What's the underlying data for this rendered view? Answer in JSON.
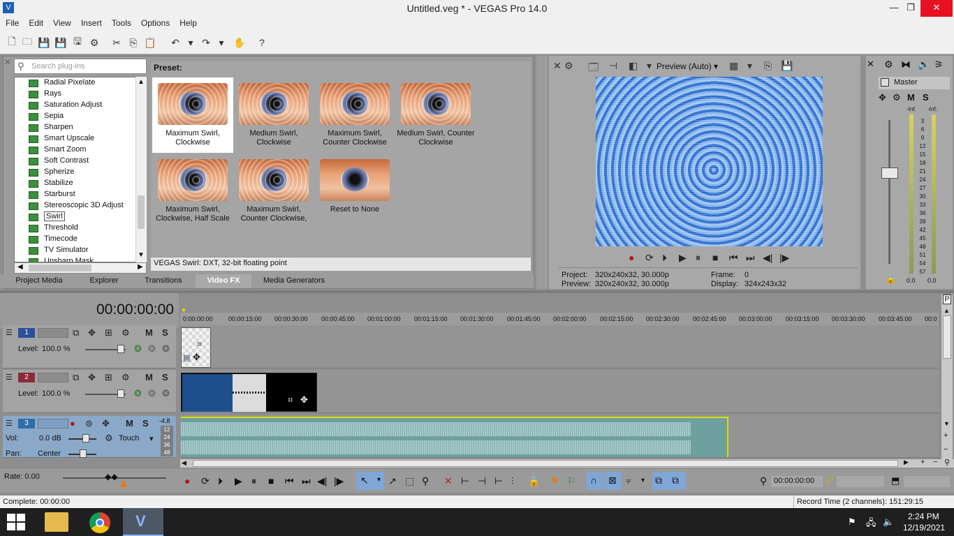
{
  "window": {
    "title": "Untitled.veg * - VEGAS Pro 14.0",
    "min": "—",
    "max": "❐",
    "close": "✕"
  },
  "menu": [
    "File",
    "Edit",
    "View",
    "Insert",
    "Tools",
    "Options",
    "Help"
  ],
  "plugins": {
    "search_placeholder": "Search plug-ins",
    "items": [
      "Radial Pixelate",
      "Rays",
      "Saturation Adjust",
      "Sepia",
      "Sharpen",
      "Smart Upscale",
      "Smart Zoom",
      "Soft Contrast",
      "Spherize",
      "Stabilize",
      "Starburst",
      "Stereoscopic 3D Adjust",
      "Swirl",
      "Threshold",
      "Timecode",
      "TV Simulator",
      "Unsharp Mask"
    ],
    "selected": "Swirl"
  },
  "presets": {
    "label": "Preset:",
    "items": [
      "Maximum Swirl, Clockwise",
      "Medium Swirl, Clockwise",
      "Maximum Swirl, Counter Clockwise",
      "Medium Swirl, Counter Clockwise",
      "Maximum Swirl, Clockwise, Half Scale",
      "Maximum Swirl, Counter Clockwise,",
      "Reset to None"
    ],
    "description": "VEGAS Swirl: DXT, 32-bit floating point"
  },
  "tabs": [
    "Project Media",
    "Explorer",
    "Transitions",
    "Video FX",
    "Media Generators"
  ],
  "active_tab": "Video FX",
  "preview": {
    "mode": "Preview (Auto)",
    "project_label": "Project:",
    "project_value": "320x240x32, 30.000p",
    "preview_label": "Preview:",
    "preview_value": "320x240x32, 30.000p",
    "frame_label": "Frame:",
    "frame_value": "0",
    "display_label": "Display:",
    "display_value": "324x243x32"
  },
  "master": {
    "label": "Master",
    "m": "M",
    "s": "S",
    "inf_left": "-Inf.",
    "inf_right": "-Inf.",
    "scale": [
      "3",
      "6",
      "9",
      "12",
      "15",
      "18",
      "21",
      "24",
      "27",
      "30",
      "33",
      "36",
      "39",
      "42",
      "45",
      "48",
      "51",
      "54",
      "57"
    ],
    "val_left": "0.0",
    "val_right": "0.0"
  },
  "timeline": {
    "timecode": "00:00:00:00",
    "ruler": [
      "0:00:00:00",
      "00:00:15:00",
      "00:00:30:00",
      "00:00:45:00",
      "00:01:00:00",
      "00:01:15:00",
      "00:01:30:00",
      "00:01:45:00",
      "00:02:00:00",
      "00:02:15:00",
      "00:02:30:00",
      "00:02:45:00",
      "00:03:00:00",
      "00:03:15:00",
      "00:03:30:00",
      "00:03:45:00",
      "00:0"
    ],
    "tracks": [
      {
        "num": "1",
        "level_label": "Level:",
        "level_value": "100.0 %",
        "m": "M",
        "s": "S"
      },
      {
        "num": "2",
        "level_label": "Level:",
        "level_value": "100.0 %",
        "m": "M",
        "s": "S"
      },
      {
        "num": "3",
        "vol_label": "Vol:",
        "vol_value": "0.0 dB",
        "pan_label": "Pan:",
        "pan_value": "Center",
        "touch": "Touch",
        "m": "M",
        "s": "S",
        "meter_top": "-4.8",
        "meter_marks": [
          "12",
          "24",
          "36",
          "48"
        ]
      }
    ]
  },
  "rate": "Rate: 0.00",
  "bottom_timecode": "00:00:00:00",
  "status": {
    "left": "Complete: 00:00:00",
    "right": "Record Time (2 channels): 151:29:15"
  },
  "taskbar": {
    "time": "2:24 PM",
    "date": "12/19/2021"
  },
  "colors": {
    "track1": "#2d4f9a",
    "track2": "#8a2a3a",
    "track3": "#2f6fa8",
    "accent": "#3a74c8"
  }
}
